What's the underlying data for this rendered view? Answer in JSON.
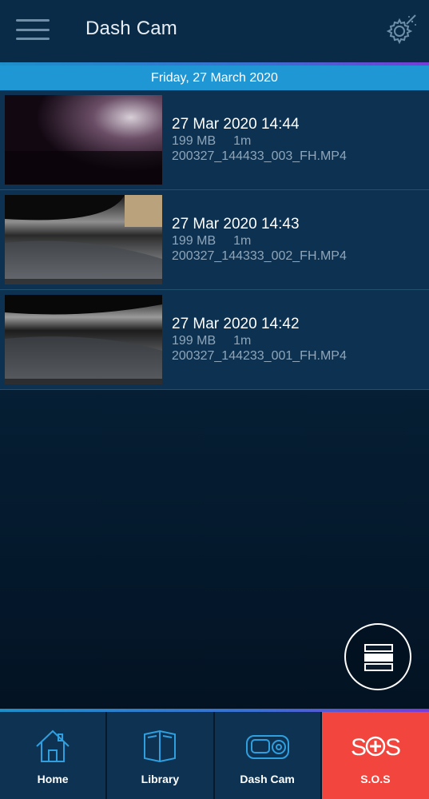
{
  "header": {
    "title": "Dash Cam",
    "menu_icon": "hamburger-menu-icon",
    "settings_icon": "gear-wand-icon"
  },
  "date_header": "Friday, 27 March 2020",
  "recordings": [
    {
      "datetime": "27 Mar 2020 14:44",
      "size": "199 MB",
      "duration": "1m",
      "filename": "200327_144433_003_FH.MP4"
    },
    {
      "datetime": "27 Mar 2020 14:43",
      "size": "199 MB",
      "duration": "1m",
      "filename": "200327_144333_002_FH.MP4"
    },
    {
      "datetime": "27 Mar 2020 14:42",
      "size": "199 MB",
      "duration": "1m",
      "filename": "200327_144233_001_FH.MP4"
    }
  ],
  "fab_icon": "view-toggle-icon",
  "nav": [
    {
      "label": "Home",
      "icon": "home-icon"
    },
    {
      "label": "Library",
      "icon": "library-book-icon"
    },
    {
      "label": "Dash Cam",
      "icon": "dash-cam-icon"
    },
    {
      "label": "S.O.S",
      "icon": "sos-icon"
    }
  ],
  "colors": {
    "header_bg": "#0a2b47",
    "date_bar": "#1e97d4",
    "row_bg": "#0d3150",
    "sos_red": "#f2453d",
    "accent_gradient_start": "#1e8fc9",
    "accent_gradient_end": "#7a3bd8"
  }
}
